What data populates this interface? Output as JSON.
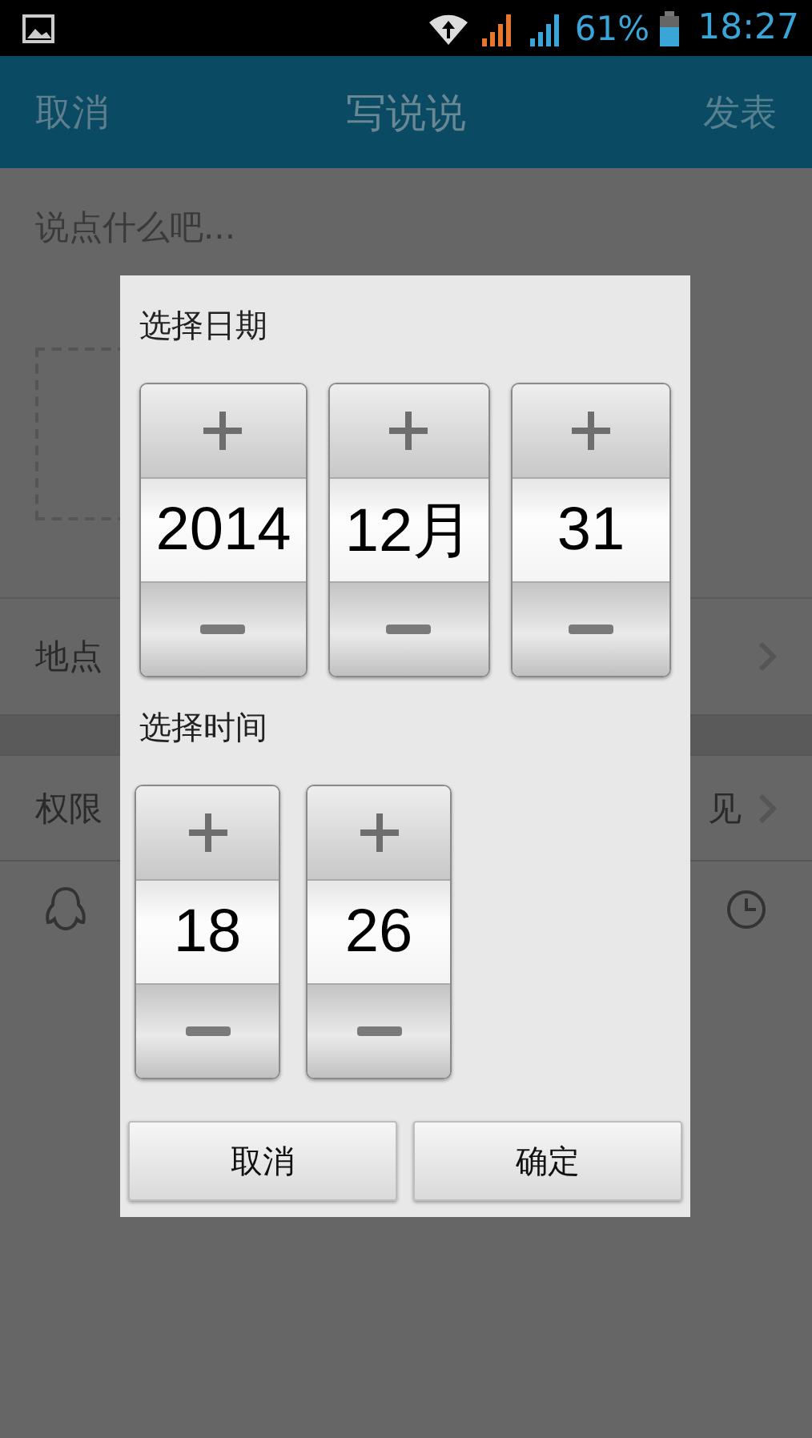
{
  "status_bar": {
    "battery": "61%",
    "time": "18:27"
  },
  "app_bar": {
    "cancel": "取消",
    "title": "写说说",
    "post": "发表",
    "post_disabled": true
  },
  "composer": {
    "placeholder": "说点什么吧..."
  },
  "rows": [
    {
      "label": "地点"
    },
    {
      "label": "权限",
      "value": "见"
    }
  ],
  "dialog": {
    "date_title": "选择日期",
    "date_spinners": [
      {
        "value": "2014"
      },
      {
        "value": "12月"
      },
      {
        "value": "31"
      }
    ],
    "time_title": "选择时间",
    "time_spinners": [
      {
        "value": "18"
      },
      {
        "value": "26"
      }
    ],
    "buttons": [
      "取消",
      "确定"
    ]
  }
}
